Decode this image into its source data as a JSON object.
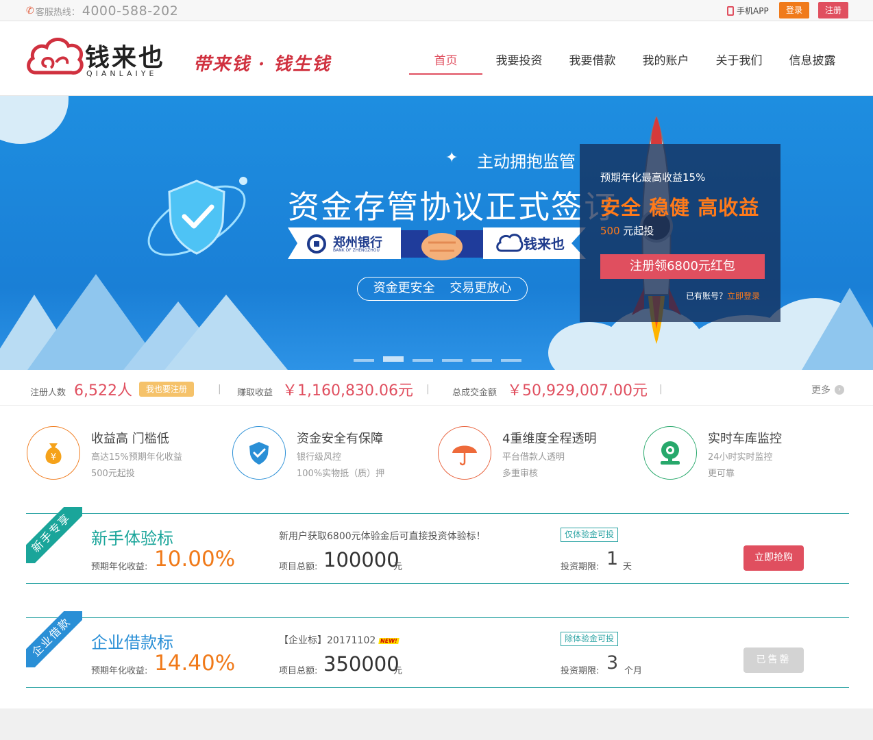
{
  "topbar": {
    "hotline_label": "客服热线：",
    "hotline_number": "4000-588-202",
    "app_label": "手机APP",
    "login_label": "登录",
    "register_label": "注册"
  },
  "header": {
    "logo_cn": "钱来也",
    "logo_en": "QIANLAIYE",
    "slogan": "带来钱 · 钱生钱",
    "nav": [
      {
        "label": "首页",
        "active": true
      },
      {
        "label": "我要投资"
      },
      {
        "label": "我要借款"
      },
      {
        "label": "我的账户"
      },
      {
        "label": "关于我们"
      },
      {
        "label": "信息披露"
      }
    ]
  },
  "banner": {
    "line1": "主动拥抱监管",
    "title": "资金存管协议正式签订",
    "bank_name": "郑州银行",
    "bank_en": "BANK OF ZHENGZHOU",
    "partner_name": "钱来也",
    "pill": "资金更安全 交易更放心",
    "slide_count": 6,
    "active_slide": 2
  },
  "promo": {
    "rate_text": "预期年化最高收益15%",
    "headline": "安全 稳健 高收益",
    "min_amount": "500",
    "min_suffix": "元起投",
    "cta": "注册领6800元红包",
    "has_account": "已有账号？",
    "login_now": "立即登录"
  },
  "stats": {
    "users_label": "注册人数",
    "users_value": "6,522人",
    "join_button": "我也要注册",
    "earned_label": "赚取收益",
    "earned_value": "￥1,160,830.06元",
    "volume_label": "总成交金额",
    "volume_value": "￥50,929,007.00元",
    "separator": "|",
    "more_label": "更多"
  },
  "features": [
    {
      "icon": "money-bag-icon",
      "color": "#f07a1a",
      "title": "收益高 门槛低",
      "line1": "高达15%预期年化收益",
      "line2": "500元起投"
    },
    {
      "icon": "shield-check-icon",
      "color": "#2a8fd6",
      "title": "资金安全有保障",
      "line1": "银行级风控",
      "line2": "100%实物抵（质）押"
    },
    {
      "icon": "umbrella-icon",
      "color": "#e8603a",
      "title": "4重维度全程透明",
      "line1": "平台借款人透明",
      "line2": "多重审核"
    },
    {
      "icon": "camera-icon",
      "color": "#27a86b",
      "title": "实时车库监控",
      "line1": "24小时实时监控",
      "line2": "更可靠"
    }
  ],
  "loans": [
    {
      "tag": "新手专享",
      "tag_color": "#1aa59a",
      "name": "新手体验标",
      "name_color": "#1aa59a",
      "rate_label": "预期年化收益:",
      "rate": "10.00%",
      "desc": "新用户获取6800元体验金后可直接投资体验标！",
      "amount_label": "项目总额:",
      "amount": "100000",
      "amount_unit": "元",
      "badge": "仅体验金可投",
      "term_label": "投资期限:",
      "term": "1",
      "term_unit": "天",
      "action": "立即抢购"
    },
    {
      "tag": "企业借款",
      "tag_color": "#2a8fd6",
      "name": "企业借款标",
      "name_color": "#2a8fd6",
      "rate_label": "预期年化收益:",
      "rate": "14.40%",
      "desc": "【企业标】20171102",
      "new_badge": "NEW!",
      "amount_label": "项目总额:",
      "amount": "350000",
      "amount_unit": "元",
      "badge": "除体验金可投",
      "term_label": "投资期限:",
      "term": "3",
      "term_unit": "个月",
      "action": "已售罄"
    }
  ]
}
